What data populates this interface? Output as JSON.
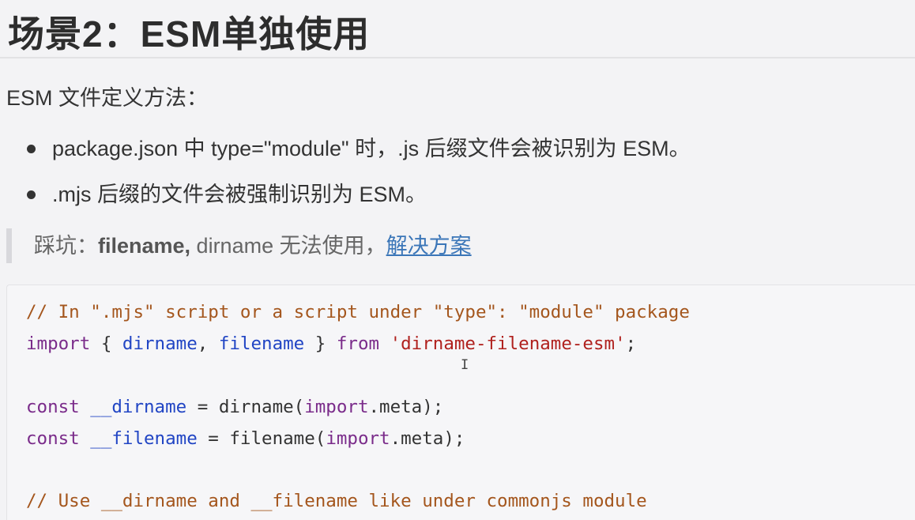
{
  "title": "场景2：ESM单独使用",
  "intro": "ESM 文件定义方法：",
  "bullets": [
    "package.json 中 type=\"module\" 时，.js 后缀文件会被识别为 ESM。",
    ".mjs 后缀的文件会被强制识别为 ESM。"
  ],
  "quote": {
    "prefix": "踩坑：",
    "bold": "filename,",
    "middle": " dirname 无法使用，",
    "link": "解决方案"
  },
  "code": {
    "line1_comment": "// In \".mjs\" script or a script under \"type\": \"module\" package",
    "line2": {
      "import": "import",
      "open": " { ",
      "dirname": "dirname",
      "comma": ", ",
      "filename": "filename",
      "close": " } ",
      "from": "from",
      "space": " ",
      "module": "'dirname-filename-esm'",
      "semi": ";"
    },
    "line3": {
      "const": "const",
      "sp": " ",
      "var": "__dirname",
      "eq": " = ",
      "call": "dirname(",
      "import": "import",
      "rest": ".meta);"
    },
    "line4": {
      "const": "const",
      "sp": " ",
      "var": "__filename",
      "eq": " = ",
      "call": "filename(",
      "import": "import",
      "rest": ".meta);"
    },
    "line5_comment": "// Use __dirname and __filename like under commonjs module"
  },
  "cursor_glyph": "I"
}
